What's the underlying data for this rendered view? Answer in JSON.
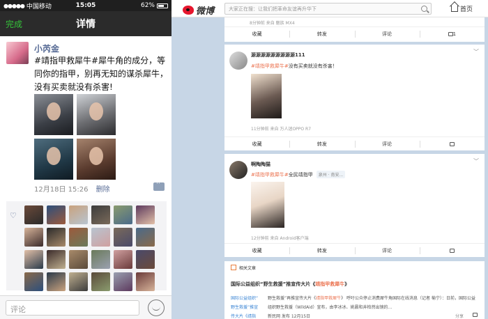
{
  "wechat": {
    "status": {
      "carrier": "中国移动",
      "time": "15:05",
      "battery": "62%"
    },
    "nav": {
      "done": "完成",
      "title": "详情"
    },
    "post": {
      "author": "小芮金",
      "text": "#靖指甲救犀牛#犀牛角的成分，等同你的指甲，别再无知的谋杀犀牛，没有买卖就没有杀害!",
      "date": "12月18日 15:26",
      "delete": "删除"
    },
    "composer": {
      "placeholder": "评论"
    }
  },
  "weibo": {
    "logo": "微博",
    "search_placeholder": "大家正在搜：让我们把革命友谊再升华下",
    "home": "首页",
    "top_card": {
      "date": "8分钟前  来自 魅族 MX4",
      "actions": [
        "收藏",
        "转发",
        "评论",
        "1"
      ]
    },
    "feed1": {
      "name": "源源源源源源源源源111",
      "tag": "#靖指甲救犀牛#",
      "text": "没有买卖就没有杀害！",
      "source": "11分钟前  来自 万人迷OPPO R7",
      "actions": [
        "收藏",
        "转发",
        "评论",
        ""
      ]
    },
    "feed2": {
      "name": "啊陶陶猫",
      "tag": "#靖指甲救犀牛#",
      "text": "全民靖指甲",
      "location": "泉州 · 南安...",
      "source": "12分钟前  来自 Android客户端",
      "actions": [
        "收藏",
        "转发",
        "评论",
        ""
      ]
    },
    "related": {
      "header": "相关文章",
      "title_prefix": "国际公益组织“野生救援”推宣传大片《",
      "title_tag": "靖指甲救犀牛",
      "title_suffix": "》",
      "links": [
        "国际公益组织“",
        "野生救援”推宣",
        "传大片《靖指"
      ],
      "body_1": "野生救援”再推宣传大片《",
      "body_tag": "靖指甲救犀牛",
      "body_2": "》 呼吁公众停止消费犀牛角国际在线消息（记者 榆宁）：日前，国际公益组织野生救援（WildAid）宣布，由李冰冰、姚晨和井柏然出镜的...",
      "footer": "新民网 发布 12月15日",
      "share": "分享"
    }
  }
}
